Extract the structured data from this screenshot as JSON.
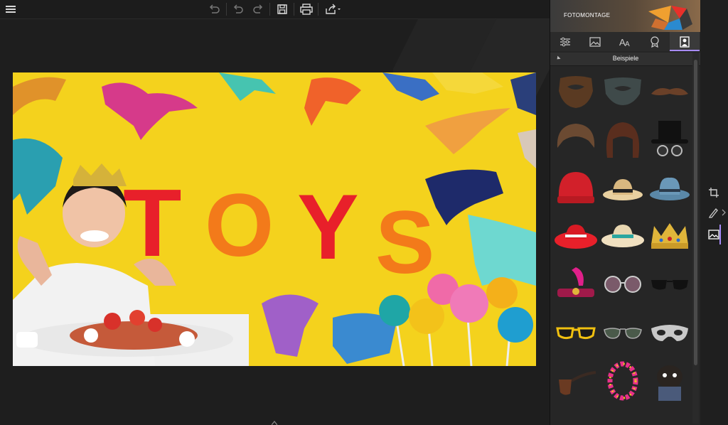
{
  "toolbar": {
    "menu_icon": "hamburger-icon",
    "actions": [
      "undo-all-icon",
      "undo-icon",
      "redo-icon",
      "save-icon",
      "print-icon",
      "share-icon"
    ]
  },
  "panel": {
    "banner_title": "FOTOMONTAGE",
    "tabs": [
      "adjust-icon",
      "image-icon",
      "text-icon",
      "badge-icon",
      "portrait-icon"
    ],
    "active_tab": "portrait-icon",
    "section_title": "Beispiele",
    "items": [
      "beard-brown",
      "beard-dark",
      "mustache",
      "hair-short-brown",
      "hair-bob-brown",
      "top-hat-glasses",
      "beanie-red",
      "straw-hat",
      "fedora-blue",
      "sun-hat-red",
      "sun-hat-teal",
      "crown-gold",
      "flapper-headband",
      "glasses-round",
      "sunglasses-black",
      "sunglasses-yellow",
      "aviator-glasses",
      "mask-silver",
      "pipe",
      "flower-lei",
      "pug-dog"
    ]
  },
  "photo": {
    "letters": [
      "T",
      "O",
      "Y",
      "S"
    ]
  },
  "rail": [
    "crop-icon",
    "pen-icon",
    "image-layer-icon"
  ],
  "colors": {
    "accent": "#a78bfa",
    "photo_bg": "#f4d21d"
  }
}
